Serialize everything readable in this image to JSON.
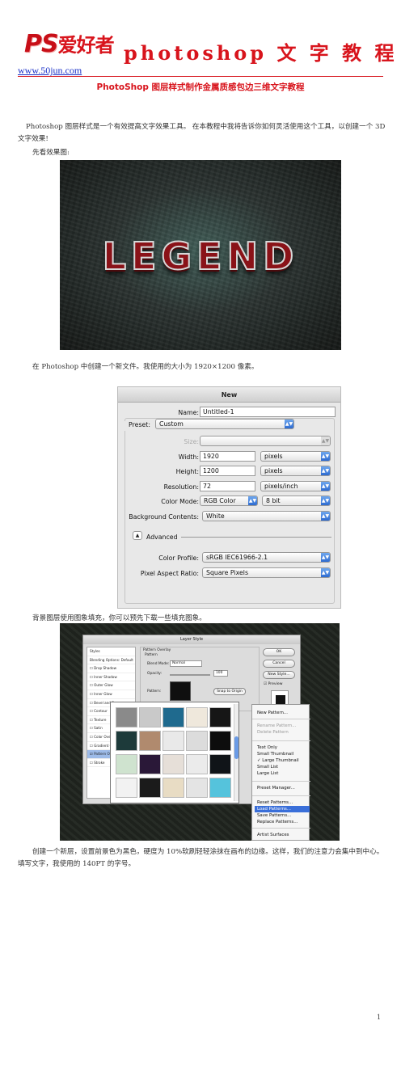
{
  "header": {
    "logo_ps": "PS",
    "logo_cn": "爱好者",
    "title": "photoshop 文 字 教 程",
    "url": "www.50jun.com"
  },
  "article": {
    "subtitle": "PhotoShop 图层样式制作金属质感包边三维文字教程",
    "p1": "Photoshop 图层样式是一个有效提高文字效果工具。 在本教程中我将告诉你如何灵活使用这个工具，以创建一个 3D 文字效果!",
    "p2": "先看效果图:",
    "p3": "在 Photoshop 中创建一个新文件。我使用的大小为 1920×1200 像素。",
    "p4": "背景图层使用图象填充，你可以预先下载一些填充图象。",
    "p5": "创建一个新层，设置前景色为黑色，硬度为 10%软刷轻轻涂抹在画布的边缘。这样，我们的注意力会集中到中心。填写文字，我使用的 140PT 的字号。"
  },
  "effect_image": {
    "text": "LEGEND"
  },
  "new_dialog": {
    "title": "New",
    "name_label": "Name:",
    "name_value": "Untitled-1",
    "preset_label": "Preset:",
    "preset_value": "Custom",
    "size_label": "Size:",
    "width_label": "Width:",
    "width_value": "1920",
    "width_unit": "pixels",
    "height_label": "Height:",
    "height_value": "1200",
    "height_unit": "pixels",
    "resolution_label": "Resolution:",
    "resolution_value": "72",
    "resolution_unit": "pixels/inch",
    "color_mode_label": "Color Mode:",
    "color_mode_value": "RGB Color",
    "bit_value": "8 bit",
    "bg_label": "Background Contents:",
    "bg_value": "White",
    "advanced_label": "Advanced",
    "profile_label": "Color Profile:",
    "profile_value": "sRGB IEC61966-2.1",
    "aspect_label": "Pixel Aspect Ratio:",
    "aspect_value": "Square Pixels"
  },
  "layer_style": {
    "title": "Layer Style",
    "styles": [
      "Styles",
      "Blending Options: Default",
      "Drop Shadow",
      "Inner Shadow",
      "Outer Glow",
      "Inner Glow",
      "Bevel and E",
      "Contour",
      "Texture",
      "Satin",
      "Color Overl",
      "Gradient O",
      "Pattern Ov",
      "Stroke"
    ],
    "section": "Pattern Overlay",
    "sub": "Pattern",
    "blend_label": "Blend Mode:",
    "blend_value": "Normal",
    "opacity_label": "Opacity:",
    "opacity_value": "100",
    "pattern_label": "Pattern:",
    "snap_button": "Snap to Origin",
    "ok": "OK",
    "cancel": "Cancel",
    "new_style": "New Style...",
    "preview": "Preview",
    "menu": [
      "New Pattern...",
      "Rename Pattern...",
      "Delete Pattern",
      "Text Only",
      "Small Thumbnail",
      "Large Thumbnail",
      "Small List",
      "Large List",
      "Preset Manager...",
      "Reset Patterns...",
      "Load Patterns...",
      "Save Patterns...",
      "Replace Patterns...",
      "Artist Surfaces"
    ],
    "swatches": [
      "#8a8a8a",
      "#c9c9c9",
      "#1f6a8e",
      "#efe8dc",
      "#161616",
      "#1d3a3a",
      "#b08a6e",
      "#e9e9e9",
      "#dcdcdc",
      "#0d0d0d",
      "#cfe3cf",
      "#2a1838",
      "#e6dfd8",
      "#ebebeb",
      "#101418",
      "#f2f2f2",
      "#1b1b1b",
      "#e8dcc4",
      "#e4e4e4",
      "#55c3dc"
    ]
  },
  "page_number": "1"
}
